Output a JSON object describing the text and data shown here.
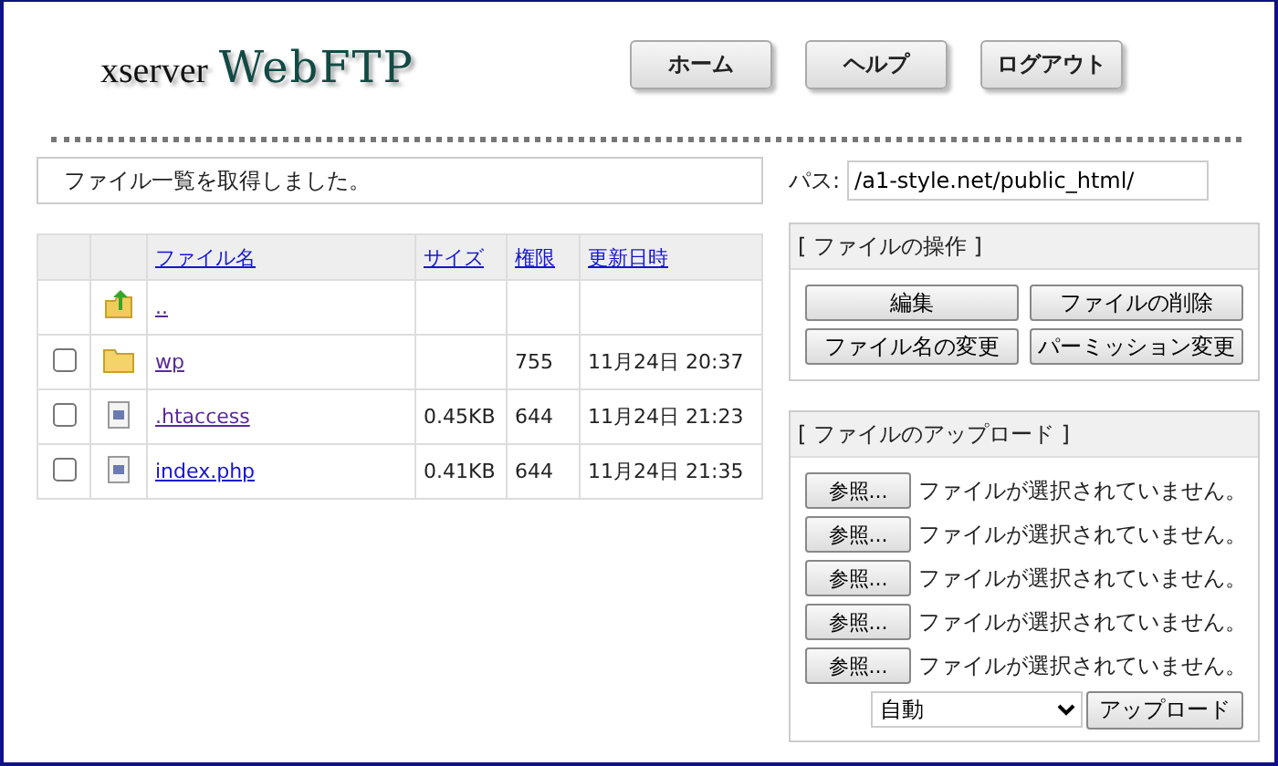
{
  "logo": {
    "prefix": "xserver",
    "name": "WebFTP"
  },
  "nav": [
    "ホーム",
    "ヘルプ",
    "ログアウト"
  ],
  "status_message": "ファイル一覧を取得しました。",
  "path": {
    "label": "パス:",
    "value": "/a1-style.net/public_html/"
  },
  "table": {
    "columns": [
      "ファイル名",
      "サイズ",
      "権限",
      "更新日時"
    ],
    "rows": [
      {
        "kind": "parent",
        "name": "..",
        "visited": true
      },
      {
        "kind": "folder",
        "checked": false,
        "name": "wp",
        "visited": true,
        "size": "",
        "permission": "755",
        "modified": "11月24日 20:37"
      },
      {
        "kind": "file",
        "checked": false,
        "name": ".htaccess",
        "visited": true,
        "size": "0.45KB",
        "permission": "644",
        "modified": "11月24日 21:23"
      },
      {
        "kind": "file",
        "checked": false,
        "name": "index.php",
        "visited": false,
        "size": "0.41KB",
        "permission": "644",
        "modified": "11月24日 21:35"
      }
    ]
  },
  "operations": {
    "title": "[ ファイルの操作 ]",
    "buttons": [
      "編集",
      "ファイルの削除",
      "ファイル名の変更",
      "パーミッション変更"
    ]
  },
  "upload": {
    "title": "[ ファイルのアップロード ]",
    "files": [
      {
        "button": "参照...",
        "status": "ファイルが選択されていません。"
      },
      {
        "button": "参照...",
        "status": "ファイルが選択されていません。"
      },
      {
        "button": "参照...",
        "status": "ファイルが選択されていません。"
      },
      {
        "button": "参照...",
        "status": "ファイルが選択されていません。"
      },
      {
        "button": "参照...",
        "status": "ファイルが選択されていません。"
      }
    ],
    "mode": "自動",
    "submit": "アップロード"
  }
}
